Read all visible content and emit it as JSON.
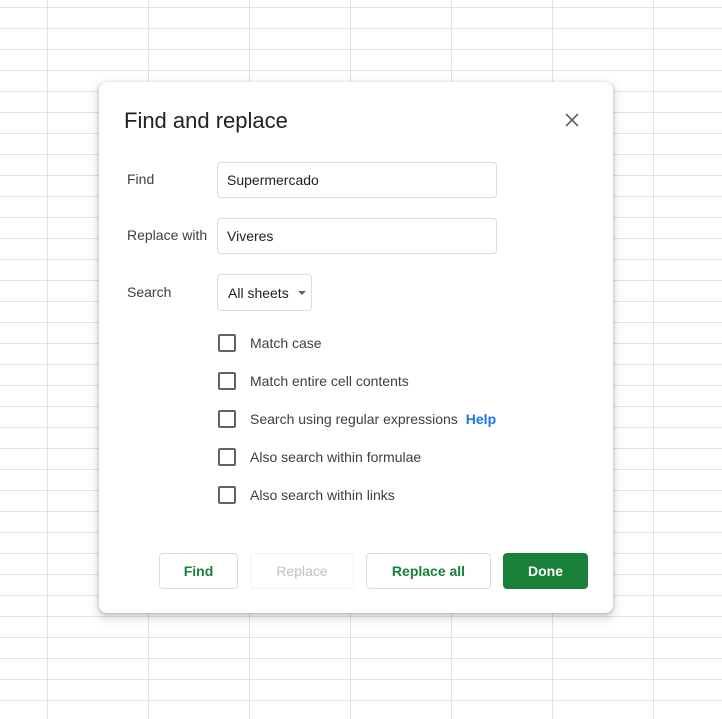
{
  "dialog": {
    "title": "Find and replace",
    "close_icon": "close-icon"
  },
  "find": {
    "label": "Find",
    "value": "Supermercado"
  },
  "replace_with": {
    "label": "Replace with",
    "value": "Viveres"
  },
  "search": {
    "label": "Search",
    "selected": "All sheets",
    "caret_icon": "caret-down-icon"
  },
  "options": [
    {
      "label": "Match case",
      "checked": false
    },
    {
      "label": "Match entire cell contents",
      "checked": false
    },
    {
      "label": "Search using regular expressions",
      "checked": false
    },
    {
      "label": "Also search within formulae",
      "checked": false
    },
    {
      "label": "Also search within links",
      "checked": false
    }
  ],
  "help_link": "Help",
  "buttons": {
    "find": "Find",
    "replace": "Replace",
    "replace_all": "Replace all",
    "done": "Done"
  },
  "colors": {
    "primary": "#188038",
    "link": "#1a73e8",
    "border": "#dadce0"
  }
}
